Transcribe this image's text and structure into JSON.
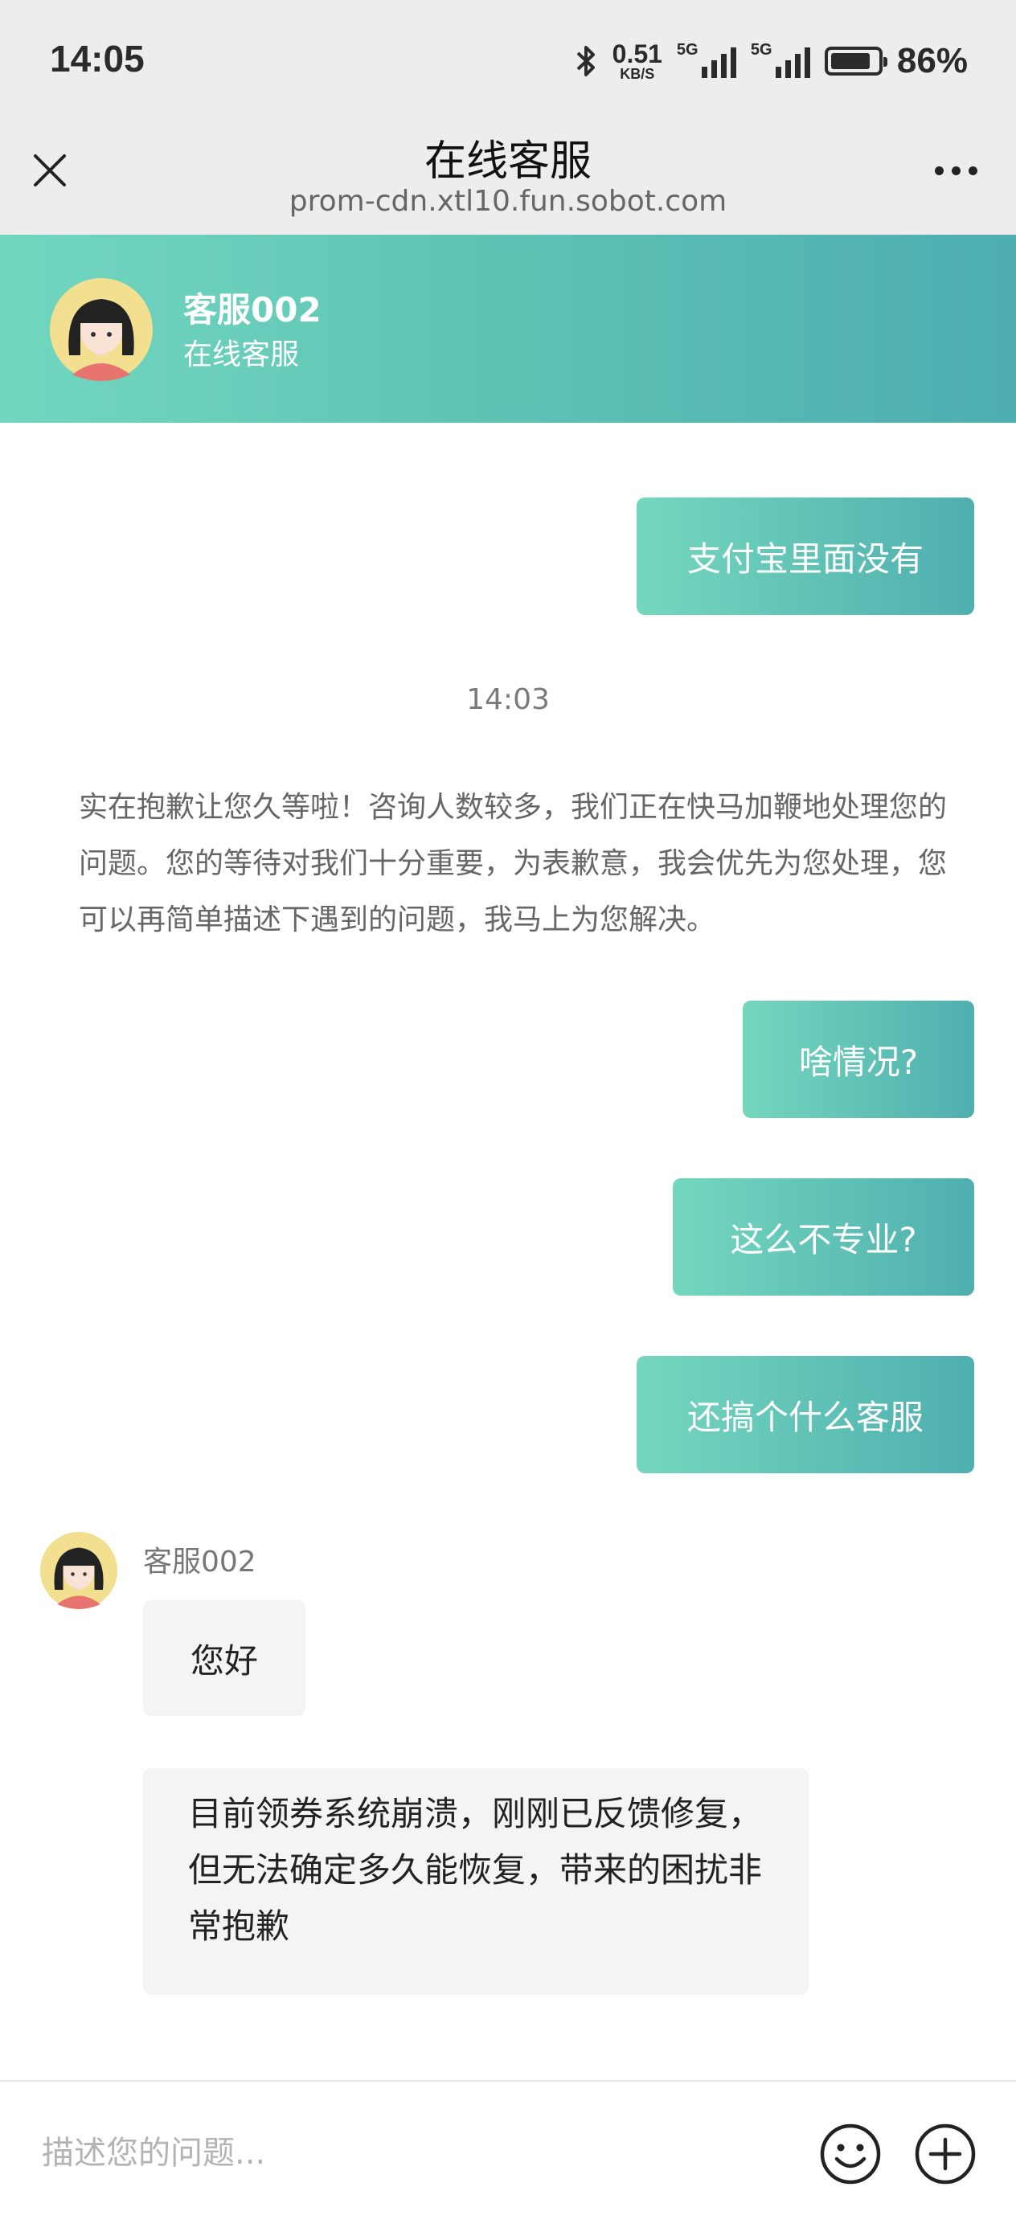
{
  "status_bar": {
    "time": "14:05",
    "net_speed_value": "0.51",
    "net_speed_unit": "KB/S",
    "signal_1_label": "5G",
    "signal_2_label": "5G",
    "battery_percent": "86%",
    "battery_level": 0.86,
    "icons": [
      "bluetooth-icon",
      "signal-icon",
      "battery-icon"
    ]
  },
  "nav": {
    "title": "在线客服",
    "subtitle": "prom-cdn.xtl10.fun.sobot.com",
    "icons": [
      "close-icon",
      "more-icon"
    ]
  },
  "agent": {
    "name": "客服002",
    "role": "在线客服"
  },
  "messages": {
    "user_1": "支付宝里面没有",
    "timestamp": "14:03",
    "system": "实在抱歉让您久等啦！咨询人数较多，我们正在快马加鞭地处理您的问题。您的等待对我们十分重要，为表歉意，我会优先为您处理，您可以再简单描述下遇到的问题，我马上为您解决。",
    "user_2": "啥情况?",
    "user_3": "这么不专业?",
    "user_4": "还搞个什么客服",
    "agent_sender": "客服002",
    "agent_1": "您好",
    "agent_2": "目前领券系统崩溃，刚刚已反馈修复，但无法确定多久能恢复，带来的困扰非常抱歉"
  },
  "input": {
    "placeholder": "描述您的问题...",
    "value": "",
    "icons": [
      "emoji-icon",
      "plus-icon"
    ]
  },
  "colors": {
    "header_gradient_start": "#72d7bf",
    "header_gradient_end": "#4eaeb1",
    "agent_bubble": "#f4f4f4",
    "status_bg": "#ededed"
  }
}
